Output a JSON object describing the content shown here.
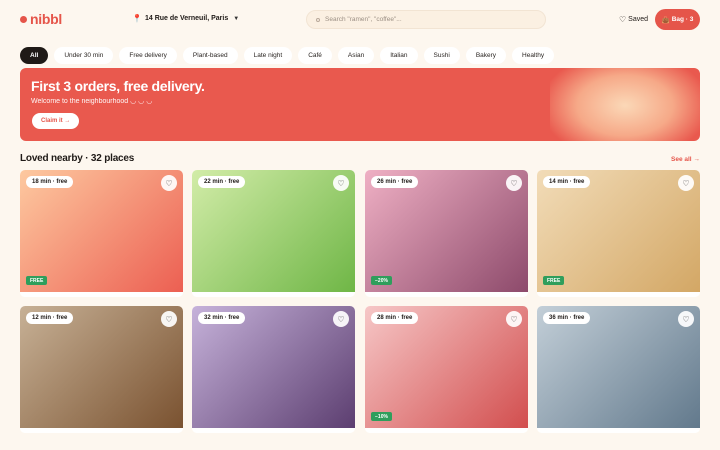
{
  "header": {
    "logo": "nibbl",
    "location": "14 Rue de Verneuil, Paris",
    "location_icon": "pin-icon",
    "search_placeholder": "Search \"ramen\", \"coffee\"...",
    "saved_label": "Saved",
    "bag_label": "Bag · 3"
  },
  "filters": [
    "All",
    "Under 30 min",
    "Free delivery",
    "Plant-based",
    "Late night",
    "Café",
    "Asian",
    "Italian",
    "Sushi",
    "Bakery",
    "Healthy"
  ],
  "hero": {
    "title": "First 3 orders, free delivery.",
    "subtitle": "Welcome to the neighbourhood ◡ ◡ ◡",
    "cta": "Claim it →"
  },
  "section": {
    "title": "Loved nearby · 32 places",
    "see_all": "See all →"
  },
  "cards": [
    {
      "time": "18 min · free",
      "promo": "FREE"
    },
    {
      "time": "22 min · free",
      "promo": ""
    },
    {
      "time": "26 min · free",
      "promo": "−20%"
    },
    {
      "time": "14 min · free",
      "promo": "FREE"
    },
    {
      "time": "12 min · free",
      "promo": ""
    },
    {
      "time": "32 min · free",
      "promo": ""
    },
    {
      "time": "28 min · free",
      "promo": "−10%"
    },
    {
      "time": "36 min · free",
      "promo": ""
    }
  ],
  "colors": {
    "accent": "#e5554a",
    "promo_green": "#2f9e5c",
    "card_gradients": [
      [
        "#fdc9a0",
        "#ec5f52"
      ],
      [
        "#d2eca8",
        "#6fb646"
      ],
      [
        "#efb0c4",
        "#8d4a6b"
      ],
      [
        "#f2dcb8",
        "#d3a765"
      ],
      [
        "#c7b196",
        "#7a5230"
      ],
      [
        "#c6b2da",
        "#5c3e70"
      ],
      [
        "#f6c7c7",
        "#d24e4e"
      ],
      [
        "#c3cfd8",
        "#62798c"
      ]
    ]
  }
}
